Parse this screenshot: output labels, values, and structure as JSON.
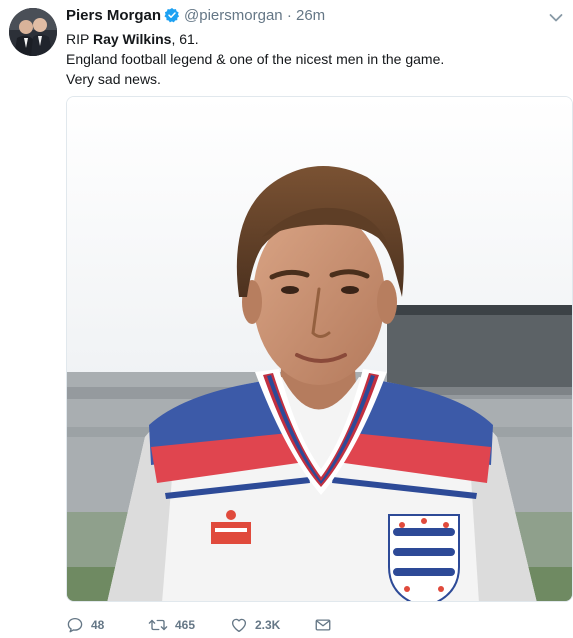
{
  "tweet": {
    "author_name": "Piers Morgan",
    "handle": "@piersmorgan",
    "separator": "·",
    "timestamp": "26m",
    "text_prefix": "RIP ",
    "text_mention": "Ray Wilkins",
    "text_suffix": ", 61.",
    "line2": "England football legend & one of the nicest men in the game.",
    "line3": "Very sad news.",
    "verified_color": "#1da1f2"
  },
  "actions": {
    "replies": "48",
    "retweets": "465",
    "likes": "2.3K",
    "reply_icon": "reply-icon",
    "retweet_icon": "retweet-icon",
    "like_icon": "heart-icon",
    "dm_icon": "envelope-icon"
  }
}
